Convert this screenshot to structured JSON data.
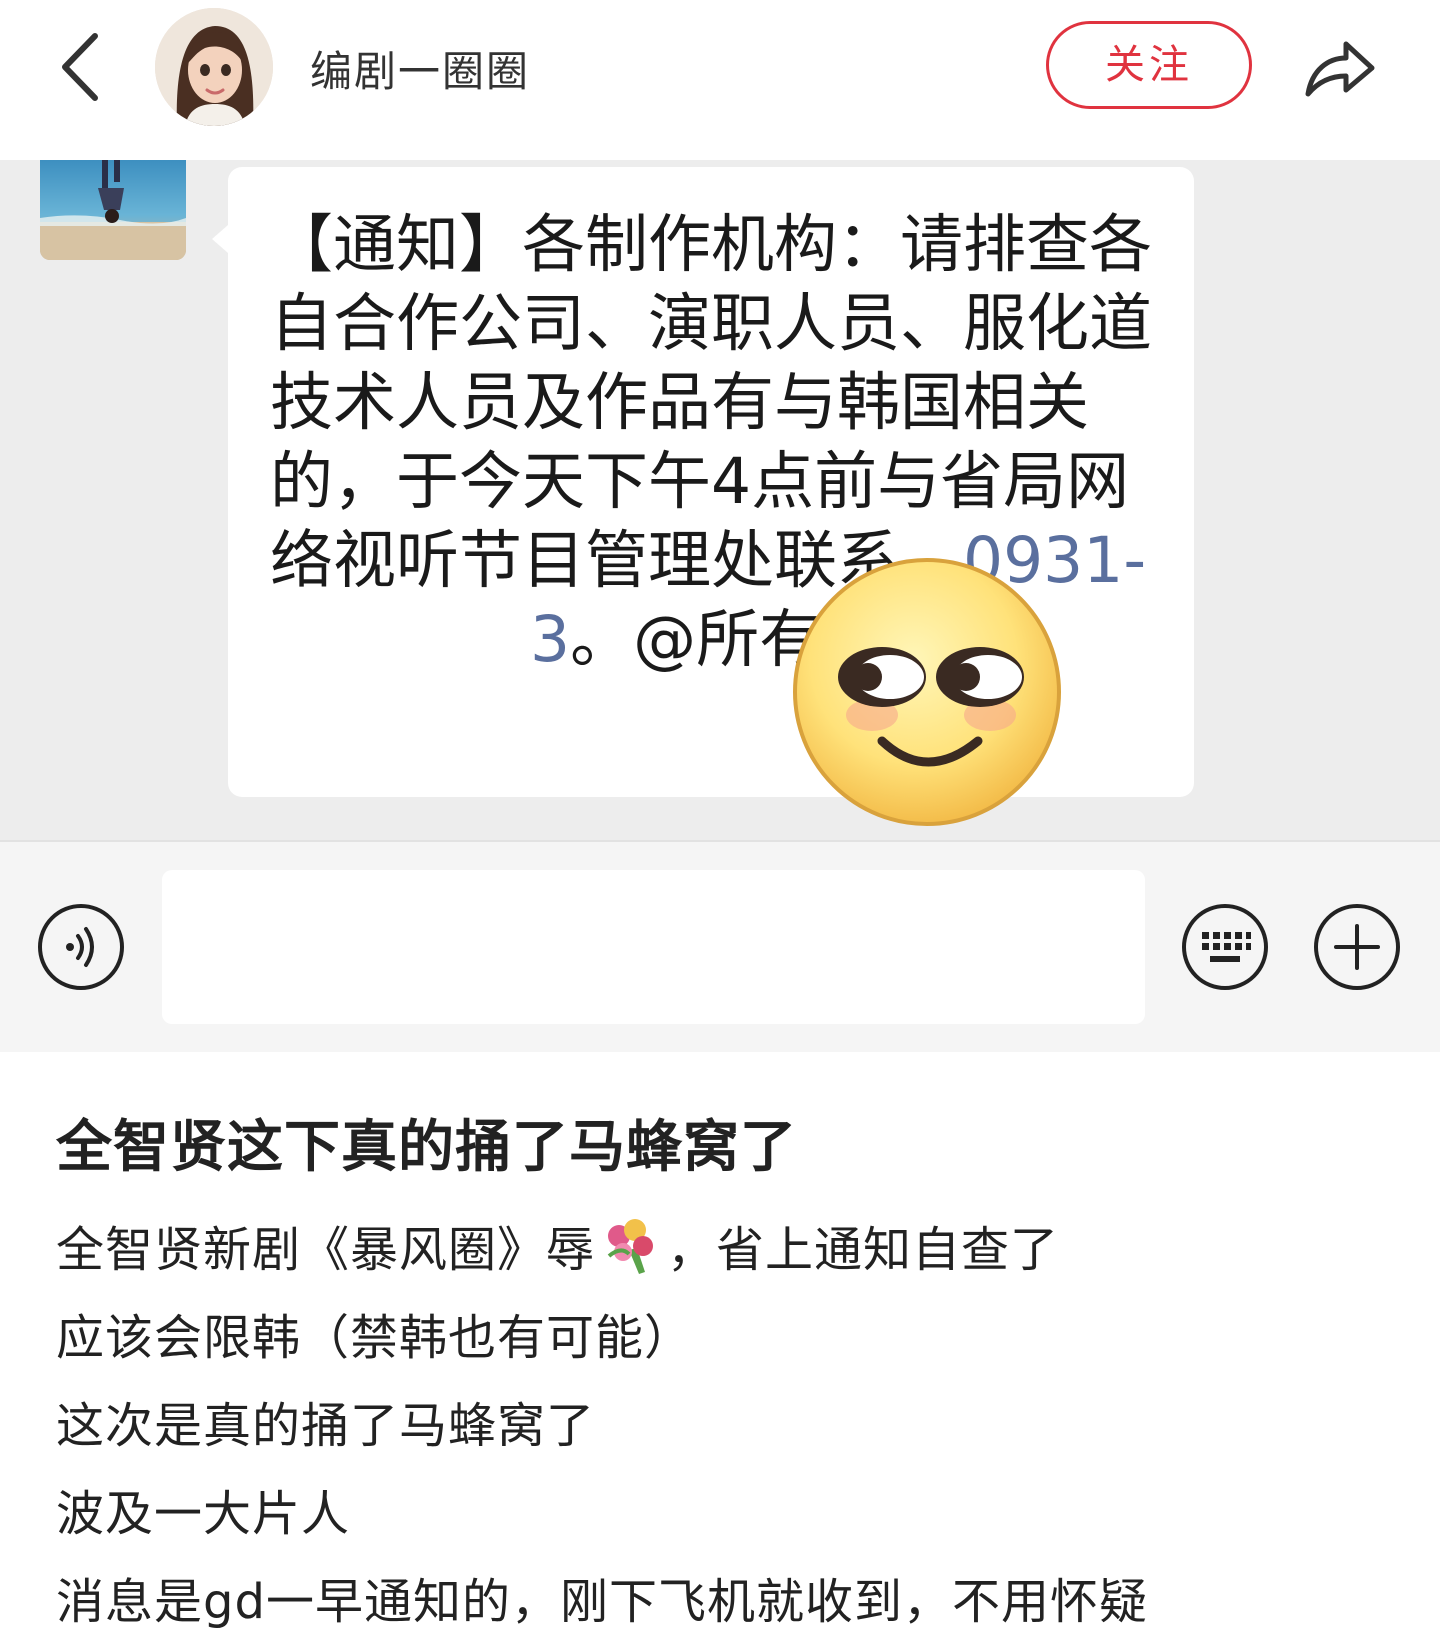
{
  "header": {
    "author_name": "编剧一圈圈",
    "follow_label": "关注"
  },
  "chat": {
    "message_parts": {
      "before_phone": "【通知】各制作机构：请排查各自合作公司、演职人员、服化道技术人员及作品有与韩国相关的，于今天下午4点前与省局网络视听节目管理处联系，",
      "phone": "0931-",
      "phone_tail": "3",
      "after_phone": "。@所有人"
    },
    "input_placeholder": ""
  },
  "post": {
    "title": "全智贤这下真的捅了马蜂窝了",
    "line1_before_emoji": "全智贤新剧《暴风圈》辱",
    "line1_after_emoji": "，省上通知自查了",
    "line2": "应该会限韩（禁韩也有可能）",
    "line3": "这次是真的捅了马蜂窝了",
    "line4": "波及一大片人",
    "line5": "消息是gd一早通知的，刚下飞机就收到，不用怀疑"
  },
  "icons": {
    "back": "chevron-left-icon",
    "share": "share-arrow-icon",
    "voice": "voice-icon",
    "keyboard": "keyboard-icon",
    "plus": "plus-icon",
    "emoji_overlay": "smirk-face-emoji",
    "flower": "bouquet-emoji"
  },
  "colors": {
    "accent_red": "#e0333f",
    "chat_background": "#ededed",
    "link_blue": "#5a6f9e"
  }
}
